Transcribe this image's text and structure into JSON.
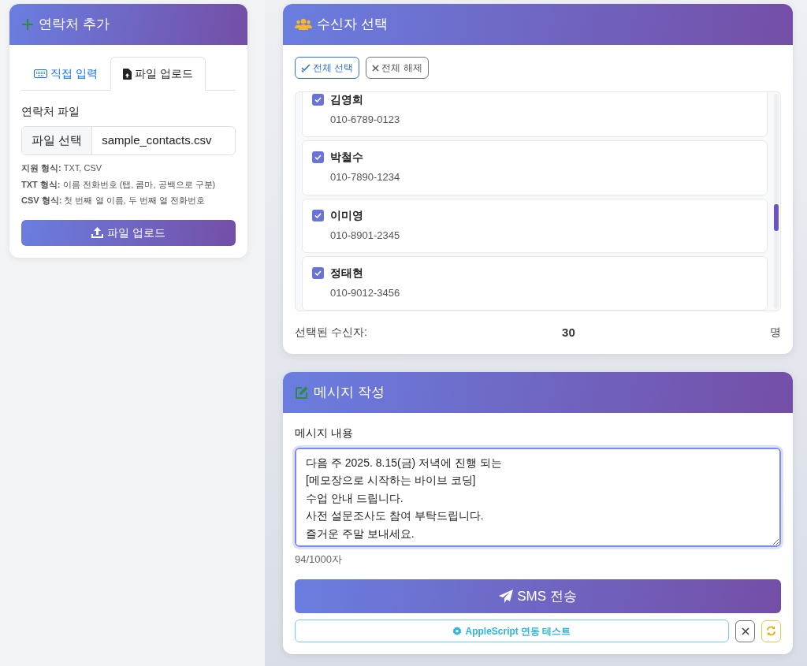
{
  "add_contact": {
    "title": "연락처 추가",
    "tabs": [
      {
        "label": "직접 입력",
        "kind": "keyboard",
        "selected": false
      },
      {
        "label": "파일 업로드",
        "kind": "file",
        "selected": true
      }
    ],
    "file_label": "연락처 파일",
    "file_button": "파일 선택",
    "file_name": "sample_contacts.csv",
    "help": [
      "**지원 형식:** TXT, CSV",
      "**TXT 형식:** 이름 전화번호 (탭, 콤마, 공백으로 구분)",
      "**CSV 형식:** 첫 번째 열 이름, 두 번째 열 전화번호"
    ],
    "upload_button": "파일 업로드"
  },
  "recipients": {
    "title": "수신자 선택",
    "select_all": "전체 선택",
    "deselect_all": "전체 해제",
    "contacts": [
      {
        "name": "김영희",
        "phone": "010-6789-0123",
        "checked": true
      },
      {
        "name": "박철수",
        "phone": "010-7890-1234",
        "checked": true
      },
      {
        "name": "이미영",
        "phone": "010-8901-2345",
        "checked": true
      },
      {
        "name": "정태현",
        "phone": "010-9012-3456",
        "checked": true
      }
    ],
    "selected_label": "선택된 수신자:",
    "selected_count": "30",
    "selected_unit": "명"
  },
  "compose": {
    "title": "메시지 작성",
    "message_label": "메시지 내용",
    "message": "다음 주 2025. 8.15(금) 저녁에 진행 되는\n[메모장으로 시작하는 바이브 코딩]\n수업 안내 드립니다.\n사전 설문조사도 참여 부탁드립니다.\n즐거운 주말 보내세요.",
    "char_count": "94/1000자",
    "send_button": "SMS 전송",
    "test_button": "AppleScript 연동 테스트"
  }
}
